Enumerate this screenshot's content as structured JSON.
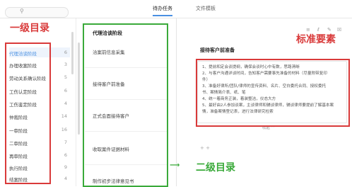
{
  "tabs": [
    {
      "label": "待办任务"
    },
    {
      "label": "文件模板"
    }
  ],
  "sidebar": {
    "items": [
      {
        "label": "代理洽谈阶段",
        "count": "6"
      },
      {
        "label": "办理收案阶段",
        "count": "3"
      },
      {
        "label": "劳动关系确认阶段",
        "count": "5"
      },
      {
        "label": "工伤认定阶段",
        "count": "6"
      },
      {
        "label": "工伤鉴定阶段",
        "count": "4"
      },
      {
        "label": "仲裁阶段",
        "count": "14"
      },
      {
        "label": "一审阶段",
        "count": "16"
      },
      {
        "label": "二审阶段",
        "count": "7"
      },
      {
        "label": "再审阶段",
        "count": "6"
      },
      {
        "label": "执行阶段",
        "count": "9"
      },
      {
        "label": "结案阶段",
        "count": "4"
      }
    ]
  },
  "middle": {
    "title": "代理洽谈阶段",
    "items": [
      {
        "label": "洽案前信息采集"
      },
      {
        "label": "接待客户前准备"
      },
      {
        "label": "正式会面接待客户"
      },
      {
        "label": "收取案件证据材料"
      },
      {
        "label": "制作初步法律意见书"
      }
    ]
  },
  "detail": {
    "title": "接待客户前准备",
    "lines": [
      "1、提前和定会谈提纲，确保会谈时心中有数，思路清晰",
      "2、与客户沟通详谈时间，告知客户需要事先准备的材料（尽量附带复印",
      "件）",
      "3、准备好律所/团队/律师的宣传资料、名片、空白委托合同、授权委托",
      "书、案情简介表、纸、笔",
      "4、统一着商务正装，着装整洁，仪态大方",
      "5、最好由2人参加谈案，主谈律师和辅谈律师，辅谈律师要提前了解基本案",
      "情，准备案情登记表，进行法律研究检索"
    ],
    "collapse_label": "收起 ^"
  },
  "annotations": {
    "level1": "一级目录",
    "level2": "二级目录",
    "standard": "标准要素"
  },
  "colors": {
    "accent": "#4a90e2",
    "annotation_red": "#d93a3a",
    "annotation_green": "#3aaa3a"
  }
}
